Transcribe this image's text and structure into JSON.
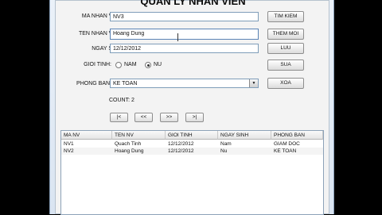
{
  "title": "QUAN LY NHAN VIEN",
  "form": {
    "ma_nv_label": "MA NHAN VIEN:",
    "ma_nv_value": "NV3",
    "ten_nv_label": "TEN NHAN VIEN:",
    "ten_nv_value": "Hoang Dung",
    "ngay_sinh_label": "NGAY SINH:",
    "ngay_sinh_value": "12/12/2012",
    "gioi_tinh_label": "GIOI TINH:",
    "gioi_tinh_options": [
      "NAM",
      "NU"
    ],
    "gioi_tinh_selected": "NU",
    "phong_ban_label": "PHONG BAN:",
    "phong_ban_value": "KE TOAN",
    "count_text": "COUNT: 2"
  },
  "buttons": {
    "tim_kiem": "TIM KIEM",
    "them_moi": "THEM MOI",
    "luu": "LUU",
    "sua": "SUA",
    "xoa": "XOA"
  },
  "nav": {
    "first": "|<",
    "prev": "<<",
    "next": ">>",
    "last": ">|"
  },
  "table": {
    "columns": [
      "MA NV",
      "TEN NV",
      "GIOI TINH",
      "NGAY SINH",
      "PHONG BAN"
    ],
    "rows": [
      [
        "NV1",
        "Quach Tinh",
        "12/12/2012",
        "Nam",
        "GIAM DOC"
      ],
      [
        "NV2",
        "Hoang Dung",
        "12/12/2012",
        "Nu",
        "KE TOAN"
      ]
    ]
  }
}
